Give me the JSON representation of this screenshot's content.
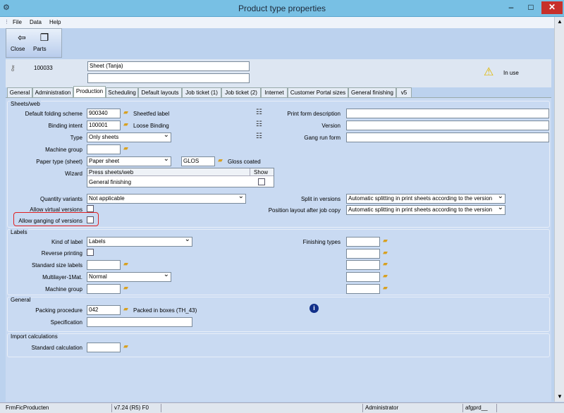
{
  "window": {
    "title": "Product type properties",
    "minimize": "–",
    "maximize": "□",
    "close": "✕"
  },
  "menu": {
    "file": "File",
    "data": "Data",
    "help": "Help"
  },
  "toolbar": {
    "close_label": "Close",
    "parts_label": "Parts"
  },
  "header": {
    "id": "100033",
    "name": "Sheet (Tanja)",
    "name2": "",
    "status": "In use"
  },
  "tabs": [
    "General",
    "Administration",
    "Production",
    "Scheduling",
    "Default layouts",
    "Job ticket (1)",
    "Job ticket (2)",
    "Internet",
    "Customer Portal sizes",
    "General finishing",
    "v5"
  ],
  "sheets_web": {
    "title": "Sheets/web",
    "default_folding_label": "Default folding scheme",
    "default_folding_value": "900340",
    "default_folding_desc": "Sheetfed label",
    "binding_label": "Binding intent",
    "binding_value": "100001",
    "binding_desc": "Loose Binding",
    "type_label": "Type",
    "type_value": "Only sheets",
    "machine_group_label": "Machine group",
    "machine_group_value": "",
    "paper_type_label": "Paper type (sheet)",
    "paper_type_value": "Paper sheet",
    "paper_code": "GLOS",
    "paper_desc": "Gloss coated",
    "wizard_label": "Wizard",
    "wizard_col1": "Press sheets/web",
    "wizard_col2": "Show",
    "wizard_row": "General finishing",
    "quantity_label": "Quantity variants",
    "quantity_value": "Not applicable",
    "virtual_label": "Allow virtual versions",
    "ganging_label": "Allow ganging of versions",
    "print_form_label": "Print form description",
    "version_label": "Version",
    "gang_run_label": "Gang run form",
    "split_label": "Split in versions",
    "split_value": "Automatic splitting in print sheets according to the version",
    "position_label": "Position layout after job copy",
    "position_value": "Automatic splitting in print sheets according to the version"
  },
  "labels": {
    "title": "Labels",
    "kind_label": "Kind of label",
    "kind_value": "Labels",
    "reverse_label": "Reverse printing",
    "standard_size_label": "Standard size labels",
    "multilayer_label": "Multilayer-1Mat.",
    "multilayer_value": "Normal",
    "machine_group_label": "Machine group",
    "finishing_label": "Finishing types"
  },
  "general": {
    "title": "General",
    "packing_label": "Packing procedure",
    "packing_value": "042",
    "packing_desc": "Packed in boxes (TH_43)",
    "spec_label": "Specification"
  },
  "import": {
    "title": "Import calculations",
    "std_calc_label": "Standard calculation"
  },
  "status": {
    "form": "FrmFicProducten",
    "version": "v7.24 (R5) F0",
    "user": "Administrator",
    "db": "afgprd__"
  }
}
